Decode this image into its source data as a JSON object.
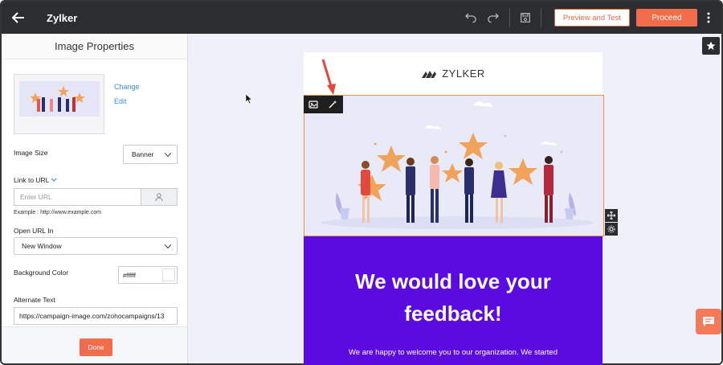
{
  "header": {
    "app_title": "Zylker",
    "preview_label": "Preview and Test",
    "proceed_label": "Proceed"
  },
  "panel": {
    "title": "Image Properties",
    "change_label": "Change",
    "edit_label": "Edit",
    "image_size_label": "Image Size",
    "image_size_value": "Banner",
    "link_label": "Link to URL",
    "url_placeholder": "Enter URL",
    "url_example": "Example : http://www.example.com",
    "open_url_label": "Open URL In",
    "open_url_value": "New Window",
    "bg_color_label": "Background Color",
    "bg_color_value": "#ffffff",
    "alt_text_label": "Alternate Text",
    "alt_text_value": "https://campaign-image.com/zohocampaigns/13",
    "done_label": "Done"
  },
  "email": {
    "logo_text": "ZYLKER",
    "headline_line1": "We would love your",
    "headline_line2": "feedback!",
    "subtext": "We are happy to welcome you to our organization. We started"
  },
  "colors": {
    "accent": "#f06c4b",
    "topbar": "#2b2d31",
    "purple": "#5b0be0",
    "selection": "#e8953e",
    "link": "#3a8fd4"
  }
}
